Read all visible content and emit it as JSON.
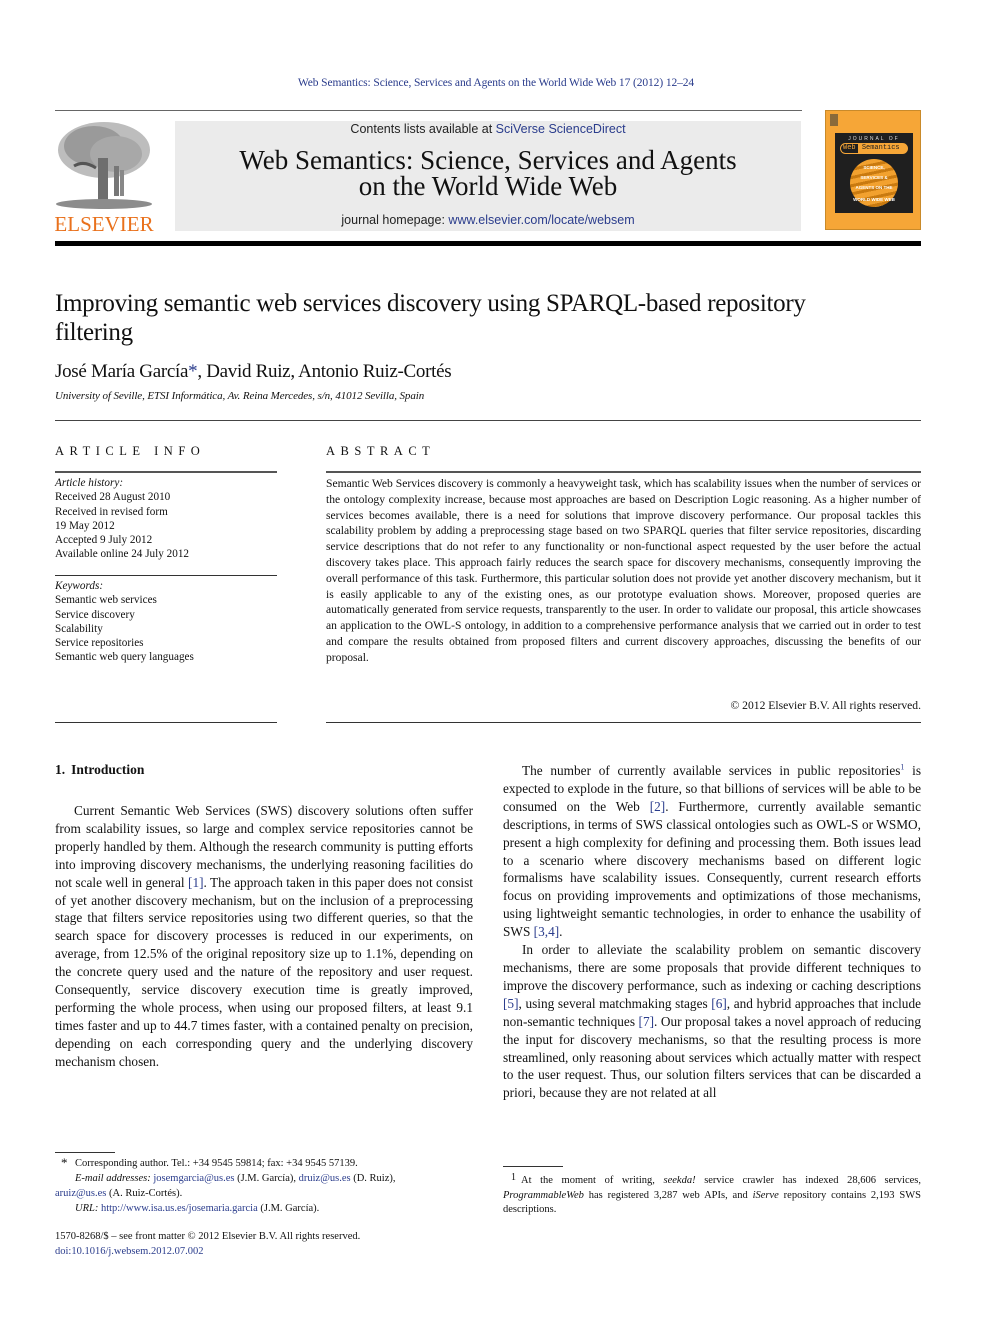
{
  "running_head": "Web Semantics: Science, Services and Agents on the World Wide Web 17 (2012) 12–24",
  "publisher": {
    "name": "ELSEVIER",
    "logo_icon": "elsevier-tree-icon",
    "brand_color": "#e9711c"
  },
  "masthead": {
    "contents_prefix": "Contents lists available at ",
    "contents_link": "SciVerse ScienceDirect",
    "journal_title_line1": "Web Semantics: Science, Services and Agents",
    "journal_title_line2": "on the World Wide Web",
    "homepage_prefix": "journal homepage: ",
    "homepage_link": "www.elsevier.com/locate/websem"
  },
  "cover": {
    "journal_of": "JOURNAL OF",
    "badge_left": "Web",
    "badge_right": "Semantics",
    "lines": [
      "SCIENCE,",
      "SERVICES &",
      "AGENTS ON THE",
      "WORLD WIDE WEB"
    ],
    "color": "#f6a637"
  },
  "article": {
    "title": "Improving semantic web services discovery using SPARQL-based repository filtering",
    "authors": [
      {
        "name": "José María García",
        "mark": "*"
      },
      {
        "name": "David Ruiz"
      },
      {
        "name": "Antonio Ruiz-Cortés"
      }
    ],
    "affiliation": "University of Seville, ETSI Informática, Av. Reina Mercedes, s/n, 41012 Sevilla, Spain"
  },
  "article_info": {
    "label": "ARTICLE INFO",
    "history_heading": "Article history:",
    "history": [
      "Received 28 August 2010",
      "Received in revised form",
      "19 May 2012",
      "Accepted 9 July 2012",
      "Available online 24 July 2012"
    ],
    "keywords_heading": "Keywords:",
    "keywords": [
      "Semantic web services",
      "Service discovery",
      "Scalability",
      "Service repositories",
      "Semantic web query languages"
    ]
  },
  "abstract": {
    "label": "ABSTRACT",
    "text": "Semantic Web Services discovery is commonly a heavyweight task, which has scalability issues when the number of services or the ontology complexity increase, because most approaches are based on Description Logic reasoning. As a higher number of services becomes available, there is a need for solutions that improve discovery performance. Our proposal tackles this scalability problem by adding a preprocessing stage based on two SPARQL queries that filter service repositories, discarding service descriptions that do not refer to any functionality or non-functional aspect requested by the user before the actual discovery takes place. This approach fairly reduces the search space for discovery mechanisms, consequently improving the overall performance of this task. Furthermore, this particular solution does not provide yet another discovery mechanism, but it is easily applicable to any of the existing ones, as our prototype evaluation shows. Moreover, proposed queries are automatically generated from service requests, transparently to the user. In order to validate our proposal, this article showcases an application to the OWL-S ontology, in addition to a comprehensive performance analysis that we carried out in order to test and compare the results obtained from proposed filters and current discovery approaches, discussing the benefits of our proposal.",
    "copyright": "© 2012 Elsevier B.V. All rights reserved."
  },
  "section1": {
    "number": "1.",
    "heading": "Introduction",
    "left_paragraph": {
      "a": "Current Semantic Web Services (SWS) discovery solutions often suffer from scalability issues, so large and complex service repositories cannot be properly handled by them. Although the research community is putting efforts into improving discovery mechanisms, the underlying reasoning facilities do not scale well in general ",
      "ref1": "[1]",
      "b": ". The approach taken in this paper does not consist of yet another discovery mechanism, but on the inclusion of a preprocessing stage that filters service repositories using two different queries, so that the search space for discovery processes is reduced in our experiments, on average, from 12.5% of the original repository size up to 1.1%, depending on the concrete query used and the nature of the repository and user request. Consequently, service discovery execution time is greatly improved, performing the whole process, when using our proposed filters, at least 9.1 times faster and up to 44.7 times faster, with a contained penalty on precision, depending on each corresponding query and the underlying discovery mechanism chosen."
    },
    "right_paragraph1": {
      "a": "The number of currently available services in public repositories",
      "fn": "1",
      "b": " is expected to explode in the future, so that billions of services will be able to be consumed on the Web ",
      "ref2": "[2]",
      "c": ". Furthermore, currently available semantic descriptions, in terms of SWS classical ontologies such as OWL-S or WSMO, present a high complexity for defining and processing them. Both issues lead to a scenario where discovery mechanisms based on different logic formalisms have scalability issues. Consequently, current research efforts focus on providing improvements and optimizations of those mechanisms, using lightweight semantic technologies, in order to enhance the usability of SWS ",
      "ref34": "[3,4]",
      "d": "."
    },
    "right_paragraph2": {
      "a": "In order to alleviate the scalability problem on semantic discovery mechanisms, there are some proposals that provide different techniques to improve the discovery performance, such as indexing or caching descriptions ",
      "ref5": "[5]",
      "b": ", using several matchmaking stages ",
      "ref6": "[6]",
      "c": ", and hybrid approaches that include non-semantic techniques ",
      "ref7": "[7]",
      "d": ". Our proposal takes a novel approach of reducing the input for discovery mechanisms, so that the resulting process is more streamlined, only reasoning about services which actually matter with respect to the user request. Thus, our solution filters services that can be discarded a priori, because they are not related at all"
    }
  },
  "footnotes": {
    "corresponding": {
      "mark": "*",
      "text": "Corresponding author. Tel.: +34 9545 59814; fax: +34 9545 57139.",
      "email_label": "E-mail addresses:",
      "emails": [
        {
          "addr": "josemgarcia@us.es",
          "who": "(J.M. García),"
        },
        {
          "addr": "druiz@us.es",
          "who": "(D. Ruiz),"
        },
        {
          "addr": "aruiz@us.es",
          "who": "(A. Ruiz-Cortés)."
        }
      ],
      "url_label": "URL:",
      "url": "http://www.isa.us.es/josemaria.garcia",
      "url_who": "(J.M. García)."
    },
    "fn1": {
      "mark": "1",
      "a": "At the moment of writing, ",
      "i1": "seekda!",
      "b": " service crawler has indexed 28,606 services, ",
      "i2": "ProgrammableWeb",
      "c": " has registered 3,287 web APIs, and ",
      "i3": "iServe",
      "d": " repository contains 2,193 SWS descriptions."
    }
  },
  "front_matter": {
    "issn_line": "1570-8268/$ – see front matter © 2012 Elsevier B.V. All rights reserved.",
    "doi": "doi:10.1016/j.websem.2012.07.002"
  },
  "colors": {
    "link": "#2a3c8c",
    "masthead_bg": "#ebebeb",
    "rule": "#000000"
  }
}
